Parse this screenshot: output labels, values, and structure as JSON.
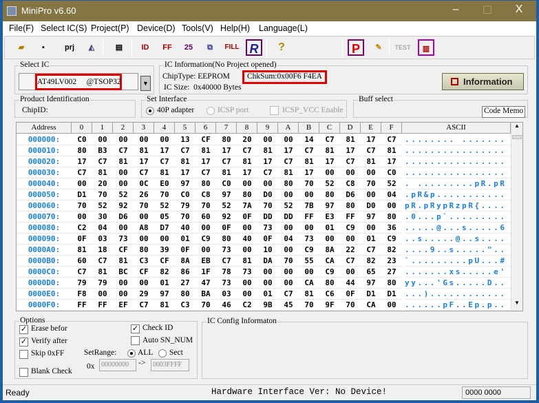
{
  "window": {
    "title": "MiniPro v6.60",
    "min": "–",
    "max": "☐",
    "close": "X"
  },
  "menu": [
    "File(F)",
    "Select IC(S)",
    "Project(P)",
    "Device(D)",
    "Tools(V)",
    "Help(H)",
    "Language(L)"
  ],
  "toolbar": {
    "prj": "prj",
    "id": "ID",
    "ff": "FF",
    "n25": "25",
    "fill": "FILL",
    "r": "R",
    "help": "?",
    "p": "P",
    "test": "TEST"
  },
  "select_ic": {
    "legend": "Select IC",
    "value": "AT49LV002     @TSOP32",
    "dropdown": "▼"
  },
  "ic_info": {
    "legend": "IC Information(No Project opened)",
    "chip_type": "ChipType: EEPROM",
    "checksum": "ChkSum:0x00F6 F4EA",
    "ic_size": "IC Size:  0x40000 Bytes",
    "information_button": "Information"
  },
  "product_id": {
    "legend": "Product Identification",
    "chip_id": "ChipID:"
  },
  "interface": {
    "legend": "Set Interface",
    "adapter": "40P adapter",
    "icsp": "ICSP port",
    "icsp_vcc": "ICSP_VCC Enable"
  },
  "buff": {
    "legend": "Buff select",
    "code_memo": "Code Memo"
  },
  "grid": {
    "headers": [
      "Address",
      "0",
      "1",
      "2",
      "3",
      "4",
      "5",
      "6",
      "7",
      "8",
      "9",
      "A",
      "B",
      "C",
      "D",
      "E",
      "F",
      "ASCII"
    ],
    "rows": [
      {
        "addr": "000000:",
        "bytes": [
          "C0",
          "00",
          "00",
          "00",
          "00",
          "13",
          "CF",
          "80",
          "20",
          "00",
          "00",
          "14",
          "C7",
          "81",
          "17",
          "C7"
        ],
        "ascii": "........ ......."
      },
      {
        "addr": "000010:",
        "bytes": [
          "80",
          "B3",
          "C7",
          "81",
          "17",
          "C7",
          "81",
          "17",
          "C7",
          "81",
          "17",
          "C7",
          "81",
          "17",
          "C7",
          "81"
        ],
        "ascii": "................"
      },
      {
        "addr": "000020:",
        "bytes": [
          "17",
          "C7",
          "81",
          "17",
          "C7",
          "81",
          "17",
          "C7",
          "81",
          "17",
          "C7",
          "81",
          "17",
          "C7",
          "81",
          "17"
        ],
        "ascii": "................"
      },
      {
        "addr": "000030:",
        "bytes": [
          "C7",
          "81",
          "00",
          "C7",
          "81",
          "17",
          "C7",
          "81",
          "17",
          "C7",
          "81",
          "17",
          "00",
          "00",
          "00",
          "C0"
        ],
        "ascii": "................"
      },
      {
        "addr": "000040:",
        "bytes": [
          "00",
          "20",
          "00",
          "0C",
          "E0",
          "97",
          "80",
          "C0",
          "00",
          "00",
          "80",
          "70",
          "52",
          "C8",
          "70",
          "52"
        ],
        "ascii": ". .........pR.pR"
      },
      {
        "addr": "000050:",
        "bytes": [
          "D1",
          "70",
          "52",
          "26",
          "70",
          "C0",
          "C8",
          "97",
          "80",
          "D0",
          "00",
          "00",
          "80",
          "D6",
          "00",
          "04"
        ],
        "ascii": ".pR&p..........."
      },
      {
        "addr": "000060:",
        "bytes": [
          "70",
          "52",
          "92",
          "70",
          "52",
          "79",
          "70",
          "52",
          "7A",
          "70",
          "52",
          "7B",
          "97",
          "80",
          "D0",
          "00"
        ],
        "ascii": "pR.pRypRzpR{...."
      },
      {
        "addr": "000070:",
        "bytes": [
          "00",
          "30",
          "D6",
          "00",
          "05",
          "70",
          "60",
          "92",
          "0F",
          "DD",
          "DD",
          "FF",
          "E3",
          "FF",
          "97",
          "80"
        ],
        "ascii": ".0...p`........."
      },
      {
        "addr": "000080:",
        "bytes": [
          "C2",
          "04",
          "00",
          "A8",
          "D7",
          "40",
          "00",
          "0F",
          "00",
          "73",
          "00",
          "00",
          "01",
          "C9",
          "00",
          "36"
        ],
        "ascii": ".....@...s.....6"
      },
      {
        "addr": "000090:",
        "bytes": [
          "0F",
          "03",
          "73",
          "00",
          "00",
          "01",
          "C9",
          "80",
          "40",
          "0F",
          "04",
          "73",
          "00",
          "00",
          "01",
          "C9"
        ],
        "ascii": "..s.....@..s...."
      },
      {
        "addr": "0000A0:",
        "bytes": [
          "81",
          "18",
          "CF",
          "80",
          "39",
          "0F",
          "00",
          "73",
          "00",
          "10",
          "00",
          "C9",
          "8A",
          "22",
          "C7",
          "82"
        ],
        "ascii": "....9..s.....\".."
      },
      {
        "addr": "0000B0:",
        "bytes": [
          "60",
          "C7",
          "81",
          "C3",
          "CF",
          "8A",
          "EB",
          "C7",
          "81",
          "DA",
          "70",
          "55",
          "CA",
          "C7",
          "82",
          "23"
        ],
        "ascii": "`.........pU...#"
      },
      {
        "addr": "0000C0:",
        "bytes": [
          "C7",
          "81",
          "BC",
          "CF",
          "82",
          "86",
          "1F",
          "78",
          "73",
          "00",
          "00",
          "00",
          "C9",
          "00",
          "65",
          "27"
        ],
        "ascii": ".......xs.....e'"
      },
      {
        "addr": "0000D0:",
        "bytes": [
          "79",
          "79",
          "00",
          "00",
          "01",
          "27",
          "47",
          "73",
          "00",
          "00",
          "00",
          "CA",
          "80",
          "44",
          "97",
          "80"
        ],
        "ascii": "yy...'Gs.....D.."
      },
      {
        "addr": "0000E0:",
        "bytes": [
          "F8",
          "00",
          "00",
          "29",
          "97",
          "80",
          "BA",
          "03",
          "00",
          "01",
          "C7",
          "81",
          "C6",
          "0F",
          "D1",
          "D1"
        ],
        "ascii": "...)............"
      },
      {
        "addr": "0000F0:",
        "bytes": [
          "FF",
          "FF",
          "EF",
          "C7",
          "81",
          "C3",
          "70",
          "46",
          "C2",
          "9B",
          "45",
          "70",
          "9F",
          "70",
          "CA",
          "00"
        ],
        "ascii": "......pF..Ep.p.."
      }
    ]
  },
  "options": {
    "legend": "Options",
    "erase": "Erase befor",
    "verify": "Verify after",
    "skip": "Skip 0xFF",
    "blank": "Blank Check",
    "check_id": "Check ID",
    "auto_sn": "Auto SN_NUM",
    "set_range": "SetRange:",
    "all": "ALL",
    "sect": "Sect",
    "ox": "0x",
    "from": "00000000",
    "arrow": "->",
    "to": "0003FFFF"
  },
  "ic_config": {
    "legend": "IC Config Informaton"
  },
  "status": {
    "left": "Ready",
    "center": "Hardware Interface Ver: No Device!",
    "right": "0000 0000"
  },
  "colors": {
    "title": "#857543",
    "highlight": "#e00000",
    "address": "#1a7fe0"
  }
}
